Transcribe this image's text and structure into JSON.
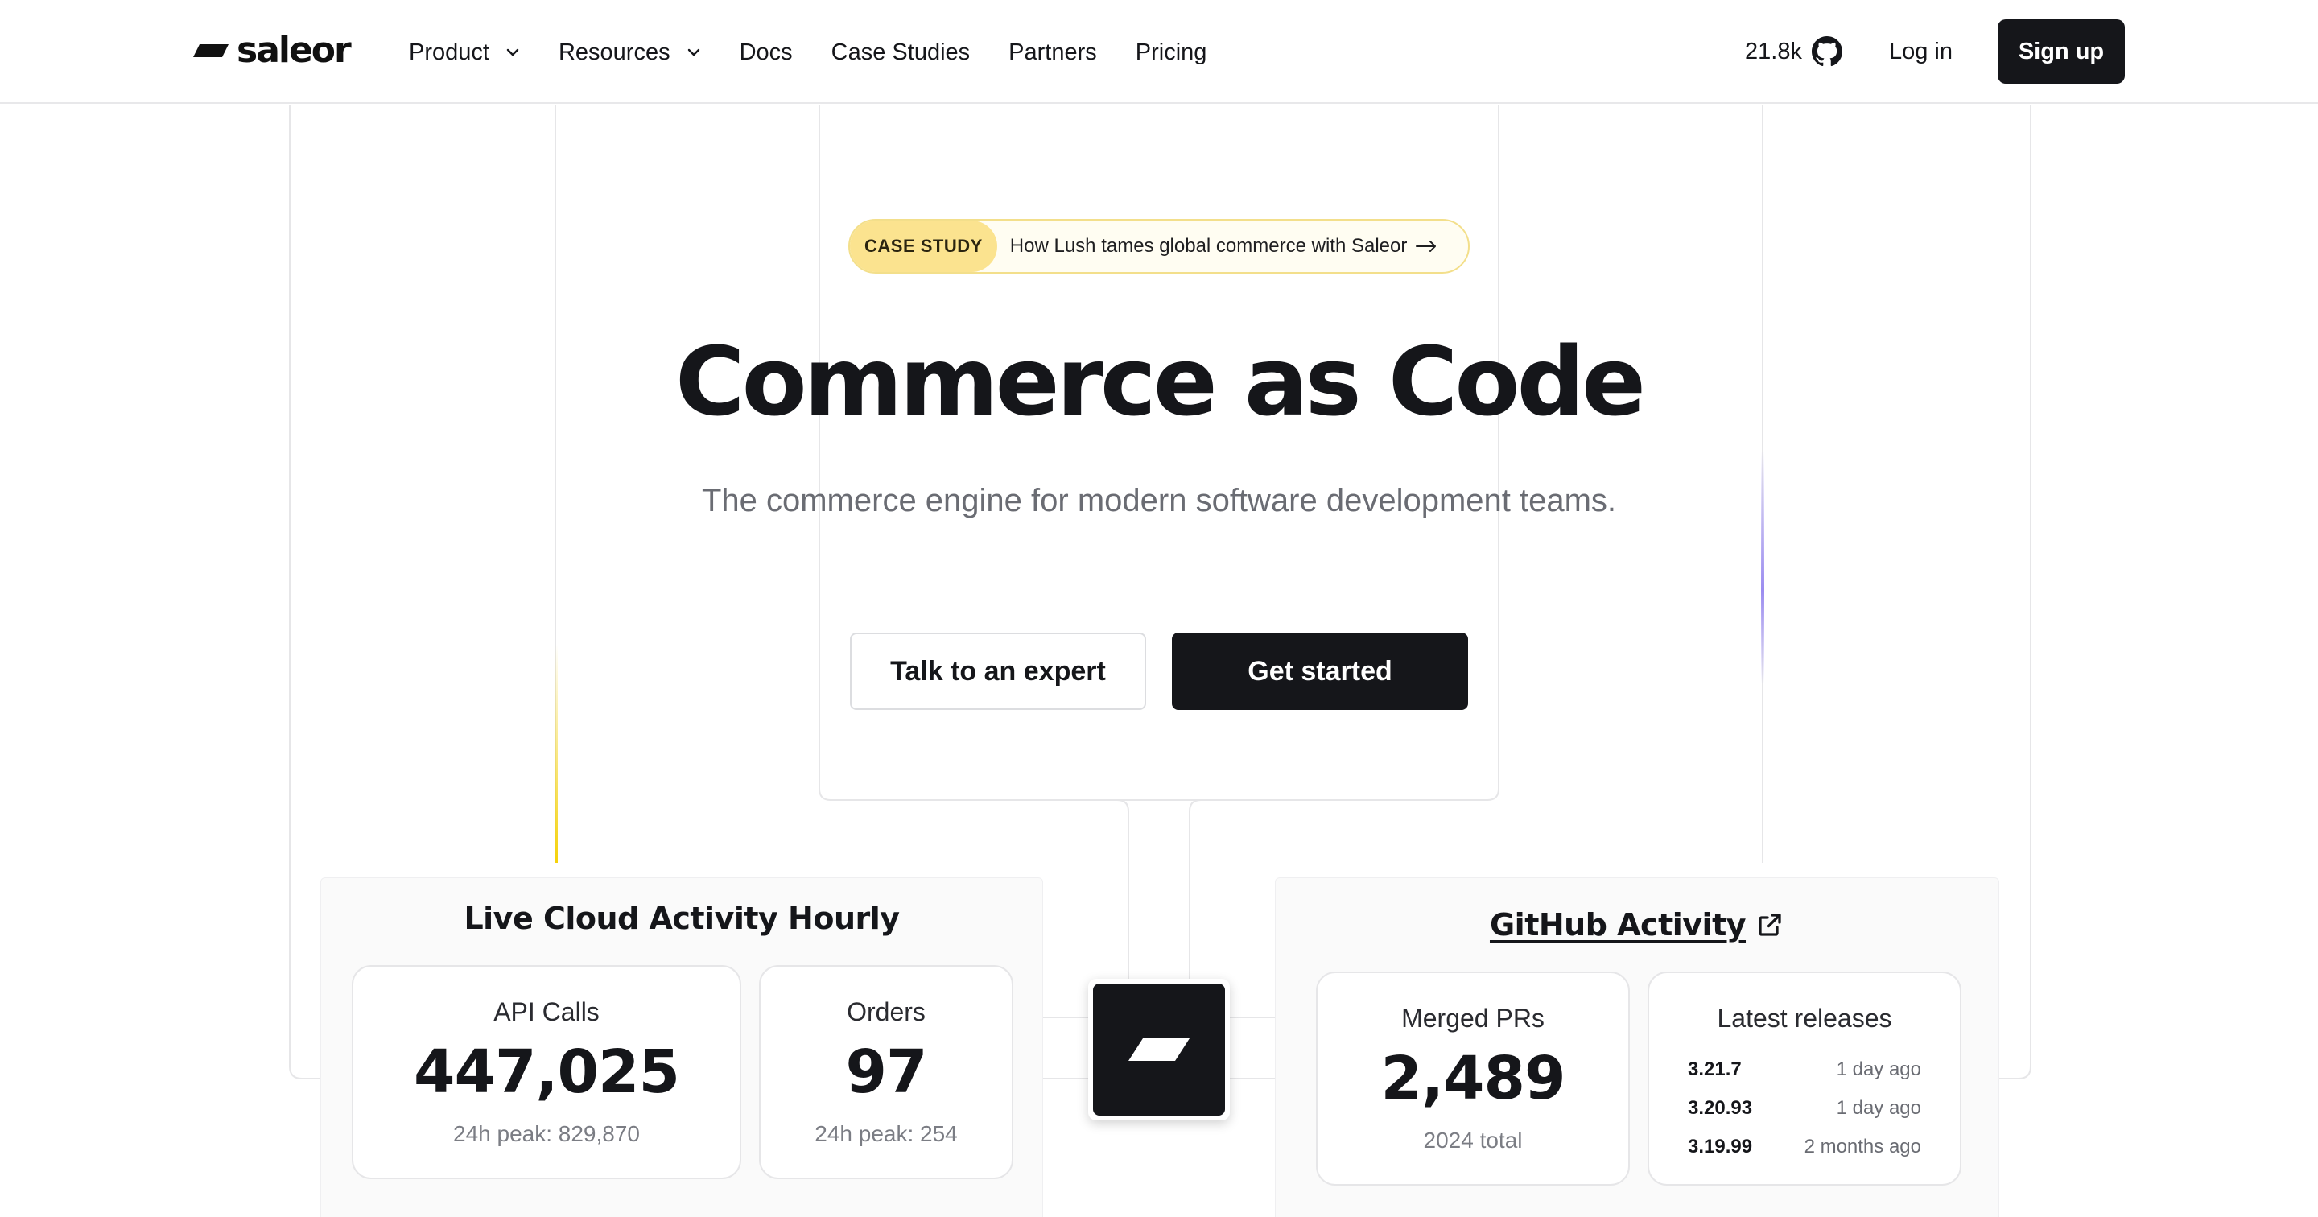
{
  "brand": {
    "name": "saleor"
  },
  "nav": {
    "items": [
      {
        "label": "Product",
        "has_dropdown": true
      },
      {
        "label": "Resources",
        "has_dropdown": true
      },
      {
        "label": "Docs",
        "has_dropdown": false
      },
      {
        "label": "Case Studies",
        "has_dropdown": false
      },
      {
        "label": "Partners",
        "has_dropdown": false
      },
      {
        "label": "Pricing",
        "has_dropdown": false
      }
    ],
    "github_stars": "21.8k",
    "login_label": "Log in",
    "signup_label": "Sign up"
  },
  "hero": {
    "badge_tag": "CASE STUDY",
    "badge_text": "How Lush tames global commerce with Saleor",
    "title": "Commerce as Code",
    "subtitle": "The commerce engine for modern software development teams.",
    "secondary_cta": "Talk to an expert",
    "primary_cta": "Get started"
  },
  "cloud_activity": {
    "title": "Live Cloud Activity Hourly",
    "api_calls": {
      "label": "API Calls",
      "value": "447,025",
      "peak": "24h peak: 829,870"
    },
    "orders": {
      "label": "Orders",
      "value": "97",
      "peak": "24h peak: 254"
    }
  },
  "github_activity": {
    "title": "GitHub Activity",
    "merged_prs": {
      "label": "Merged PRs",
      "value": "2,489",
      "sub": "2024 total"
    },
    "latest_releases": {
      "label": "Latest releases",
      "items": [
        {
          "version": "3.21.7",
          "time": "1 day ago"
        },
        {
          "version": "3.20.93",
          "time": "1 day ago"
        },
        {
          "version": "3.19.99",
          "time": "2 months ago"
        }
      ]
    }
  },
  "colors": {
    "dark": "#15161a",
    "badge_yellow": "#fbe38f",
    "accent_yellow": "#f5d20a",
    "accent_purple": "#9b8cf0"
  }
}
